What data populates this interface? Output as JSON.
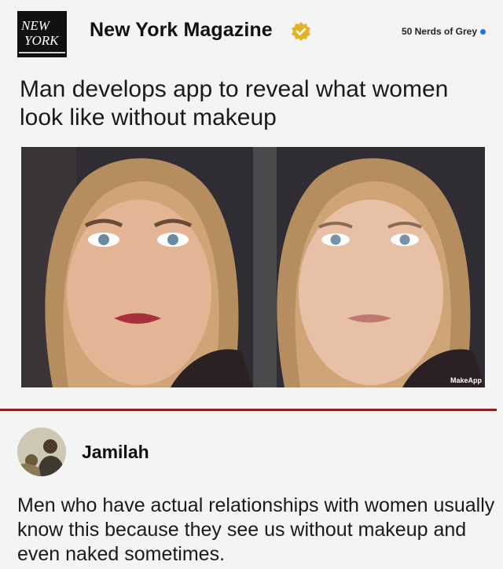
{
  "post": {
    "logo_line1": "NEW",
    "logo_line2": "YORK",
    "publisher": "New York Magazine",
    "source_tag": "50 Nerds of Grey",
    "headline": "Man develops app to reveal what women look like without makeup",
    "image_watermark": "MakeApp"
  },
  "comment": {
    "author": "Jamilah",
    "text": "Men who have actual relationships with women usually know this because they see us without makeup and even naked sometimes."
  },
  "colors": {
    "divider": "#8a1f1f",
    "verified_badge": "#e2b325",
    "source_dot": "#1e73e8"
  },
  "icons": {
    "verified": "verified-badge-icon",
    "source": "blue-dot-icon"
  }
}
